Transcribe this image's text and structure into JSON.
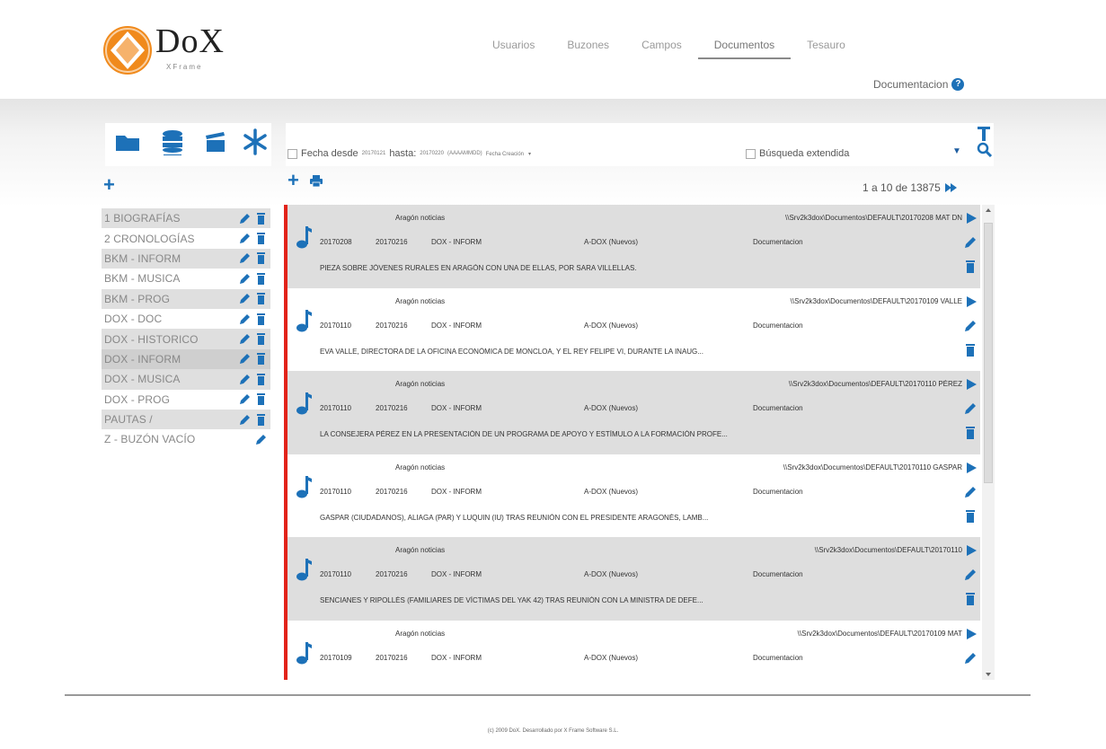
{
  "brand": {
    "name": "DoX",
    "sub": "XFrame",
    "accent": "#f08a1c",
    "blue": "#1d71b8",
    "red": "#e2231a"
  },
  "nav": {
    "items": [
      "Usuarios",
      "Buzones",
      "Campos",
      "Documentos",
      "Tesauro"
    ],
    "active": "Documentos",
    "documentation": "Documentacion"
  },
  "toolbar": {
    "icons": [
      "folder-icon",
      "database-icon",
      "clapperboard-icon",
      "asterisk-icon"
    ]
  },
  "filter": {
    "date_from_label": "Fecha desde",
    "date_from": "20170121",
    "date_to_label": "hasta:",
    "date_to": "20170220",
    "format": "(AAAAMMDD)",
    "sort_select": "Fecha Creación",
    "extended_label": "Búsqueda extendida"
  },
  "pager": {
    "text": "1 a 10 de 13875"
  },
  "folders": [
    {
      "label": "1 BIOGRAFÍAS",
      "style": "shade",
      "delete": true
    },
    {
      "label": "2 CRONOLOGÍAS",
      "style": "plain",
      "delete": true
    },
    {
      "label": "BKM - INFORM",
      "style": "shade",
      "delete": true
    },
    {
      "label": "BKM - MUSICA",
      "style": "plain",
      "delete": true
    },
    {
      "label": "BKM - PROG",
      "style": "shade",
      "delete": true
    },
    {
      "label": "DOX - DOC",
      "style": "plain",
      "delete": true
    },
    {
      "label": "DOX - HISTORICO",
      "style": "shade",
      "delete": true
    },
    {
      "label": "DOX - INFORM",
      "style": "sel",
      "delete": true
    },
    {
      "label": "DOX - MUSICA",
      "style": "shade",
      "delete": true
    },
    {
      "label": "DOX - PROG",
      "style": "plain",
      "delete": true
    },
    {
      "label": "PAUTAS /",
      "style": "shade",
      "delete": true
    },
    {
      "label": "Z - BUZÓN VACÍO",
      "style": "plain",
      "delete": false
    }
  ],
  "documents": [
    {
      "source": "Aragón noticias",
      "path": "\\\\Srv2k3dox\\Documentos\\DEFAULT\\20170208 MAT DN",
      "date1": "20170208",
      "date2": "20170216",
      "folder": "DOX - INFORM",
      "status": "A-DOX (Nuevos)",
      "user": "Documentacion",
      "summary": "PIEZA SOBRE JÓVENES RURALES EN ARAGÓN CON UNA DE ELLAS, POR SARA VILLELLAS.",
      "style": "shade"
    },
    {
      "source": "Aragón noticias",
      "path": "\\\\Srv2k3dox\\Documentos\\DEFAULT\\20170109 VALLE",
      "date1": "20170110",
      "date2": "20170216",
      "folder": "DOX - INFORM",
      "status": "A-DOX (Nuevos)",
      "user": "Documentacion",
      "summary": "EVA VALLE, DIRECTORA DE LA OFICINA ECONÓMICA DE MONCLOA, Y EL REY FELIPE VI, DURANTE LA INAUG...",
      "style": "plain"
    },
    {
      "source": "Aragón noticias",
      "path": "\\\\Srv2k3dox\\Documentos\\DEFAULT\\20170110 PÉREZ",
      "date1": "20170110",
      "date2": "20170216",
      "folder": "DOX - INFORM",
      "status": "A-DOX (Nuevos)",
      "user": "Documentacion",
      "summary": "LA CONSEJERA PÉREZ EN LA PRESENTACIÓN DE UN PROGRAMA DE APOYO Y ESTÍMULO A LA FORMACIÓN PROFE...",
      "style": "shade"
    },
    {
      "source": "Aragón noticias",
      "path": "\\\\Srv2k3dox\\Documentos\\DEFAULT\\20170110 GASPAR",
      "date1": "20170110",
      "date2": "20170216",
      "folder": "DOX - INFORM",
      "status": "A-DOX (Nuevos)",
      "user": "Documentacion",
      "summary": "GASPAR (CIUDADANOS), ALIAGA (PAR) Y LUQUIN (IU) TRAS REUNIÓN CON EL PRESIDENTE ARAGONÉS, LAMB...",
      "style": "plain"
    },
    {
      "source": "Aragón noticias",
      "path": "\\\\Srv2k3dox\\Documentos\\DEFAULT\\20170110",
      "date1": "20170110",
      "date2": "20170216",
      "folder": "DOX - INFORM",
      "status": "A-DOX (Nuevos)",
      "user": "Documentacion",
      "summary": "SENCIANES Y RIPOLLÉS (FAMILIARES DE VÍCTIMAS DEL YAK 42) TRAS REUNIÓN CON LA MINISTRA DE DEFE...",
      "style": "shade"
    },
    {
      "source": "Aragón noticias",
      "path": "\\\\Srv2k3dox\\Documentos\\DEFAULT\\20170109 MAT",
      "date1": "20170109",
      "date2": "20170216",
      "folder": "DOX - INFORM",
      "status": "A-DOX (Nuevos)",
      "user": "Documentacion",
      "summary": "",
      "style": "plain"
    }
  ],
  "footer": {
    "text": "(c) 2009 DoX. Desarrollado por X Frame Software S.L."
  }
}
